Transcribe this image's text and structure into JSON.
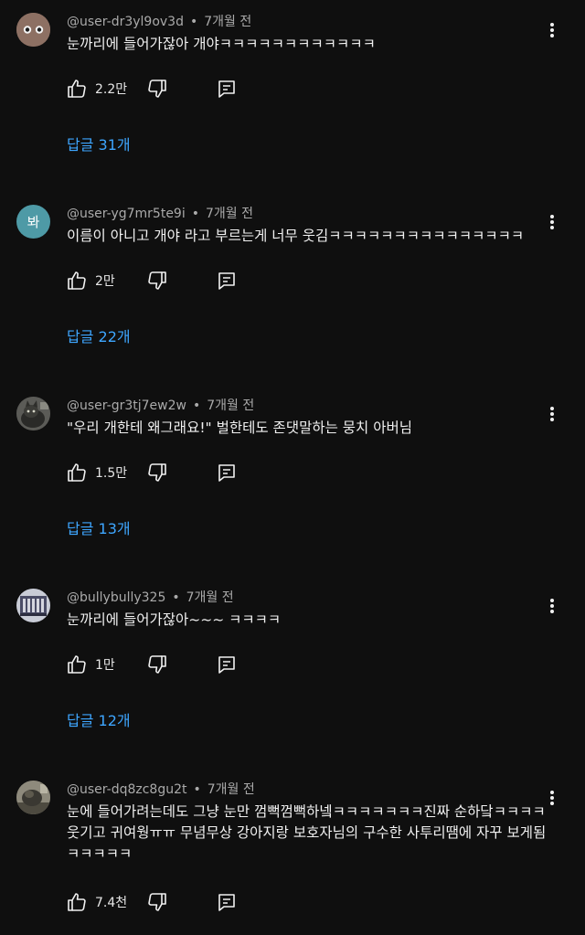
{
  "comments": [
    {
      "author": "@user-dr3yl9ov3d",
      "time": "7개월 전",
      "text": "눈까리에 들어가잖아 개야ㅋㅋㅋㅋㅋㅋㅋㅋㅋㅋㅋㅋ",
      "likes": "2.2만",
      "replies": "답글 31개",
      "avatar": "eyes-face"
    },
    {
      "author": "@user-yg7mr5te9i",
      "time": "7개월 전",
      "text": "이름이 아니고 개야 라고 부르는게 너무 웃김ㅋㅋㅋㅋㅋㅋㅋㅋㅋㅋㅋㅋㅋㅋㅋ",
      "likes": "2만",
      "replies": "답글 22개",
      "avatar_text": "봐",
      "avatar_color": "#4e9aa6"
    },
    {
      "author": "@user-gr3tj7ew2w",
      "time": "7개월 전",
      "text": "\"우리 개한테 왜그래요!\" 벌한테도 존댓말하는 뭉치 아버님",
      "likes": "1.5만",
      "replies": "답글 13개",
      "avatar": "photo-cat"
    },
    {
      "author": "@bullybully325",
      "time": "7개월 전",
      "text": "눈까리에 들어가잖아~~~ ㅋㅋㅋㅋ",
      "likes": "1만",
      "replies": "답글 12개",
      "avatar": "photo-building"
    },
    {
      "author": "@user-dq8zc8gu2t",
      "time": "7개월 전",
      "text": "눈에 들어가려는데도 그냥 눈만 껌뻑껌뻑하넼ㅋㅋㅋㅋㅋㅋㅋ진짜 순하닼ㅋㅋㅋㅋ웃기고 귀여웡ㅠㅠ 무념무상 강아지랑 보호자님의 구수한 사투리땜에 자꾸 보게됨 ㅋㅋㅋㅋㅋ",
      "likes": "7.4천",
      "avatar": "photo-dog"
    }
  ],
  "icons": {
    "like": "thumbs-up-icon",
    "dislike": "thumbs-down-icon",
    "reply": "reply-comment-icon",
    "more": "more-vertical-icon"
  },
  "colors": {
    "background": "#0f0f0f",
    "link": "#3ea6ff",
    "meta": "#aaaaaa"
  }
}
